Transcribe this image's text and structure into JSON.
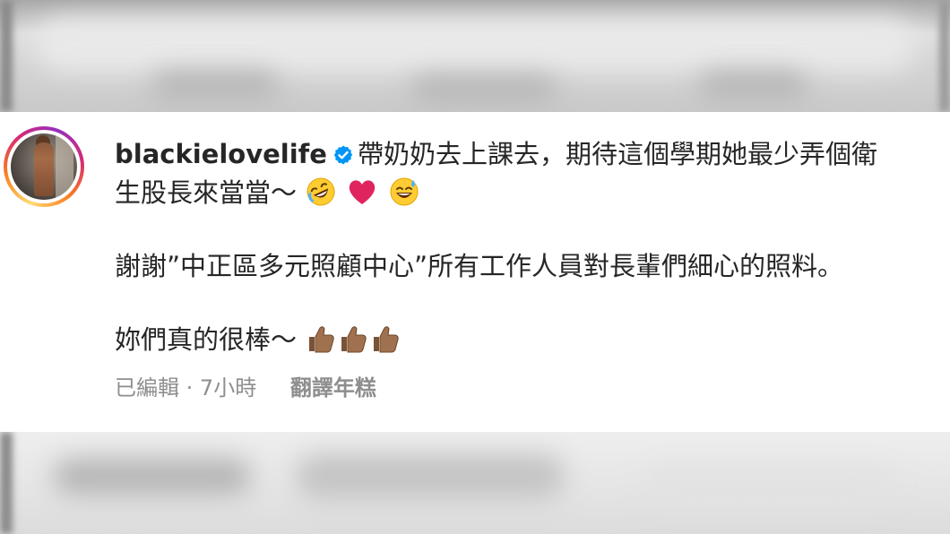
{
  "comment": {
    "username": "blackielovelife",
    "verified": true,
    "line1": "帶奶奶去上課去，期待這個學期她最少弄個衛",
    "line2": "生股長來當當～",
    "line2_emojis": [
      "rolling-laughing-emoji",
      "red-heart-emoji",
      "grinning-sweat-emoji"
    ],
    "paragraph2": "謝謝”中正區多元照顧中心”所有工作人員對長輩們細心的照料。",
    "paragraph3": "妳們真的很棒～",
    "paragraph3_emojis": [
      "thumbs-up-emoji",
      "thumbs-up-emoji",
      "thumbs-up-emoji"
    ]
  },
  "meta": {
    "edited": "已編輯",
    "separator": "·",
    "time": "7小時",
    "translate": "翻譯年糕"
  },
  "colors": {
    "text": "#262626",
    "muted": "#8e8e8e",
    "verified_blue": "#0095f6",
    "heart_red": "#e0245e",
    "thumb_brown": "#a0714f"
  }
}
